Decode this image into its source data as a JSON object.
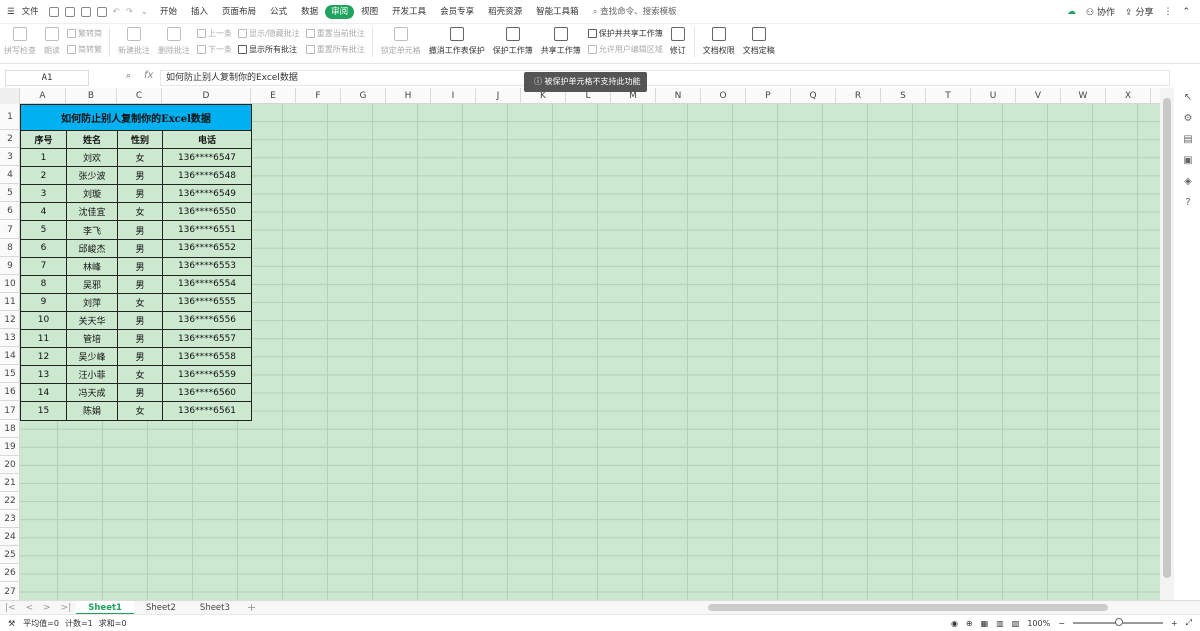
{
  "menu": {
    "file": "文件",
    "items": [
      "开始",
      "插入",
      "页面布局",
      "公式",
      "数据",
      "审阅",
      "视图",
      "开发工具",
      "会员专享",
      "稻壳资源",
      "智能工具箱"
    ],
    "active_index": 5,
    "search": "查找命令、搜索模板",
    "collab": "协作",
    "share": "分享"
  },
  "ribbon": {
    "spell": "拼写检查",
    "read": "朗读",
    "t2s": "繁转简",
    "s2t": "简转繁",
    "new_comment": "新建批注",
    "del_comment": "删除批注",
    "prev": "上一条",
    "next": "下一条",
    "show_hide": "显示/隐藏批注",
    "show_all": "显示所有批注",
    "reset_cur": "重置当前批注",
    "reset_all": "重置所有批注",
    "lock_cell": "锁定单元格",
    "unprotect": "撤消工作表保护",
    "protect_wb": "保护工作簿",
    "share_wb": "共享工作簿",
    "protect_share": "保护并共享工作簿",
    "allow_edit": "允许用户编辑区域",
    "revise": "修订",
    "doc_perm": "文档权限",
    "doc_final": "文档定稿"
  },
  "formula": {
    "cell_ref": "A1",
    "fx": "fx",
    "content": "如何防止别人复制你的Excel数据"
  },
  "toast": "被保护单元格不支持此功能",
  "columns": [
    "A",
    "B",
    "C",
    "D",
    "E",
    "F",
    "G",
    "H",
    "I",
    "J",
    "K",
    "L",
    "M",
    "N",
    "O",
    "P",
    "Q",
    "R",
    "S",
    "T",
    "U",
    "V",
    "W",
    "X"
  ],
  "rows": [
    "1",
    "2",
    "3",
    "4",
    "5",
    "6",
    "7",
    "8",
    "9",
    "10",
    "11",
    "12",
    "13",
    "14",
    "15",
    "16",
    "17",
    "18",
    "19",
    "20",
    "21",
    "22",
    "23",
    "24",
    "25",
    "26",
    "27"
  ],
  "table": {
    "title": "如何防止别人复制你的Excel数据",
    "headers": [
      "序号",
      "姓名",
      "性别",
      "电话"
    ],
    "data": [
      [
        "1",
        "刘欢",
        "女",
        "136****6547"
      ],
      [
        "2",
        "张少波",
        "男",
        "136****6548"
      ],
      [
        "3",
        "刘璇",
        "男",
        "136****6549"
      ],
      [
        "4",
        "沈佳宜",
        "女",
        "136****6550"
      ],
      [
        "5",
        "李飞",
        "男",
        "136****6551"
      ],
      [
        "6",
        "邱峻杰",
        "男",
        "136****6552"
      ],
      [
        "7",
        "林峰",
        "男",
        "136****6553"
      ],
      [
        "8",
        "吴邪",
        "男",
        "136****6554"
      ],
      [
        "9",
        "刘萍",
        "女",
        "136****6555"
      ],
      [
        "10",
        "关天华",
        "男",
        "136****6556"
      ],
      [
        "11",
        "管培",
        "男",
        "136****6557"
      ],
      [
        "12",
        "吴少峰",
        "男",
        "136****6558"
      ],
      [
        "13",
        "汪小菲",
        "女",
        "136****6559"
      ],
      [
        "14",
        "冯天成",
        "男",
        "136****6560"
      ],
      [
        "15",
        "陈娟",
        "女",
        "136****6561"
      ]
    ]
  },
  "sheets": [
    "Sheet1",
    "Sheet2",
    "Sheet3"
  ],
  "status": {
    "avg": "平均值=0",
    "count": "计数=1",
    "sum": "求和=0",
    "zoom": "100%"
  },
  "colors": {
    "accent": "#1fa35e",
    "title_fill": "#00b0f0",
    "cell_fill": "#cce8cf"
  }
}
